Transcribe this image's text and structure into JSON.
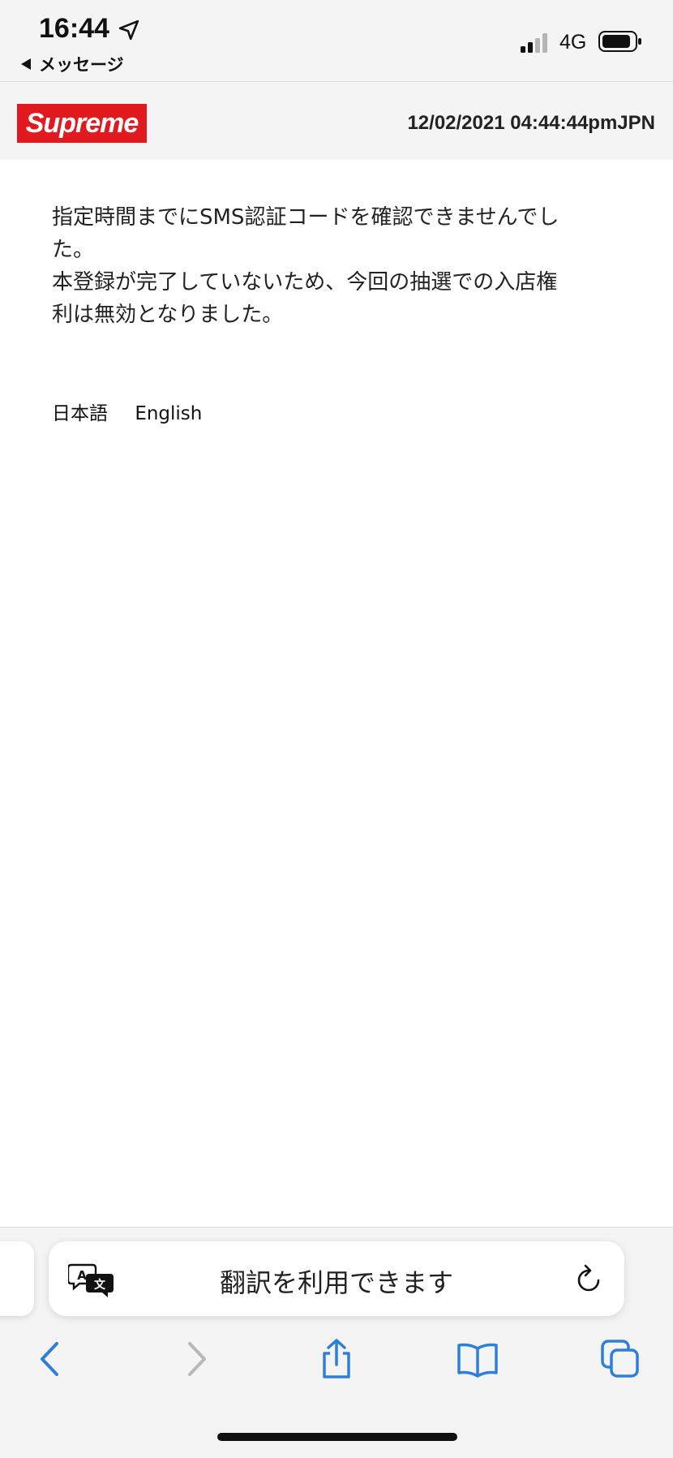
{
  "status_bar": {
    "time": "16:44",
    "back_app": "メッセージ",
    "network": "4G"
  },
  "header": {
    "logo_text": "Supreme",
    "timestamp": "12/02/2021 04:44:44pmJPN",
    "logo_color": "#e2191e"
  },
  "content": {
    "message_lines": [
      "指定時間までにSMS認証コードを確認できませんでし",
      "た。",
      "本登録が完了していないため、今回の抽選での入店権",
      "利は無効となりました。"
    ],
    "languages": [
      "日本語",
      "English"
    ]
  },
  "browser": {
    "translate_label": "翻訳を利用できます",
    "accent_color": "#2f7fd8",
    "toolbar_icons": [
      "back-icon",
      "forward-icon",
      "share-icon",
      "bookmarks-icon",
      "tabs-icon"
    ]
  }
}
